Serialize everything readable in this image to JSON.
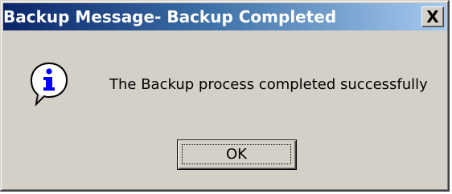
{
  "window": {
    "title": "Backup Message- Backup Completed",
    "close_label": "X"
  },
  "icon": "information-icon",
  "message": {
    "text": "The Backup process completed successfully"
  },
  "buttons": {
    "ok_label": "OK"
  },
  "colors": {
    "titlebar_start": "#0a246a",
    "titlebar_end": "#a6caf0",
    "dialog_face": "#d4d0c8",
    "icon_glyph": "#0000ff"
  }
}
